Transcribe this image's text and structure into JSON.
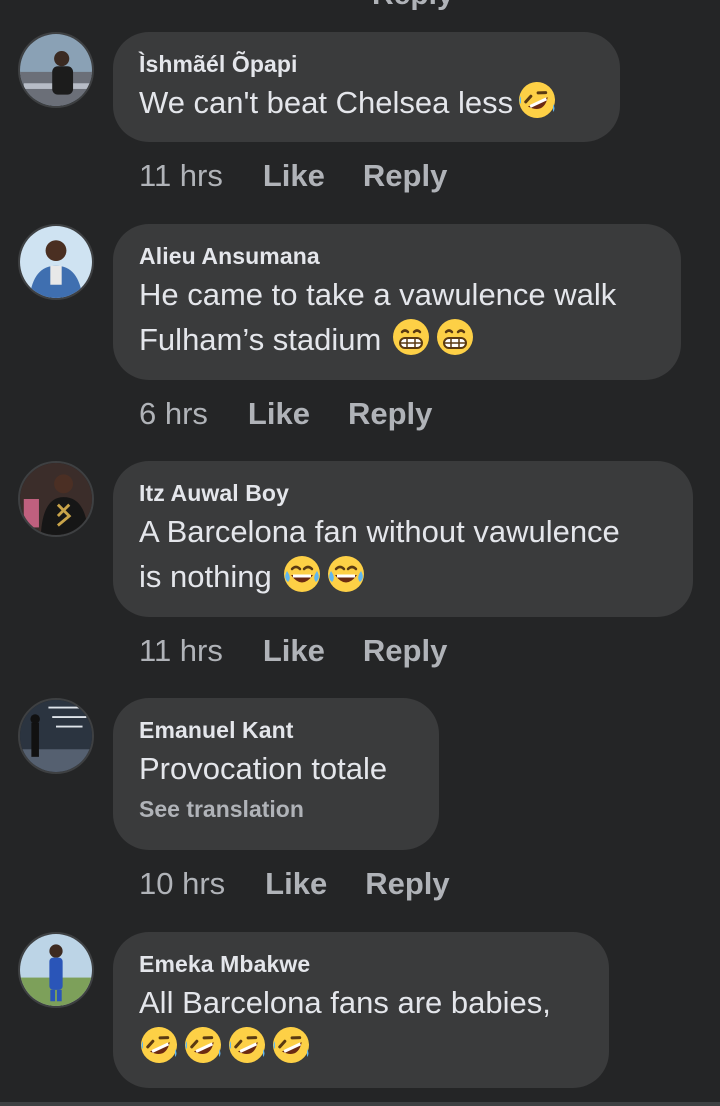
{
  "top_fragment": "Reply",
  "comments": [
    {
      "author": "Ìshmãél Õpapi",
      "lines": [
        "We can't beat Chelsea less"
      ],
      "time": "11 hrs",
      "like": "Like",
      "reply": "Reply",
      "emojis": [
        "rofl-emoji"
      ]
    },
    {
      "author": "Alieu Ansumana",
      "lines": [
        "He came to take a vawulence walk",
        "Fulham’s stadium"
      ],
      "time": "6 hrs",
      "like": "Like",
      "reply": "Reply",
      "emojis": [
        "grin-emoji",
        "grin-emoji"
      ]
    },
    {
      "author": "Itz Auwal Boy",
      "lines": [
        "A Barcelona fan without vawulence",
        "is nothing"
      ],
      "time": "11 hrs",
      "like": "Like",
      "reply": "Reply",
      "emojis": [
        "joy-emoji",
        "joy-emoji"
      ]
    },
    {
      "author": "Emanuel Kant",
      "lines": [
        "Provocation totale"
      ],
      "see_translation": "See translation",
      "time": "10 hrs",
      "like": "Like",
      "reply": "Reply",
      "emojis": []
    },
    {
      "author": "Emeka Mbakwe",
      "lines": [
        "All Barcelona fans are babies,"
      ],
      "time": "",
      "like": "",
      "reply": "",
      "emojis": [
        "rofl-emoji",
        "rofl-emoji",
        "rofl-emoji",
        "rofl-emoji"
      ]
    }
  ],
  "colors": {
    "background": "#242526",
    "bubble": "#3a3b3c",
    "primary_text": "#e4e6eb",
    "secondary_text": "#b0b3b8",
    "emoji_yellow": "#fdd046"
  }
}
